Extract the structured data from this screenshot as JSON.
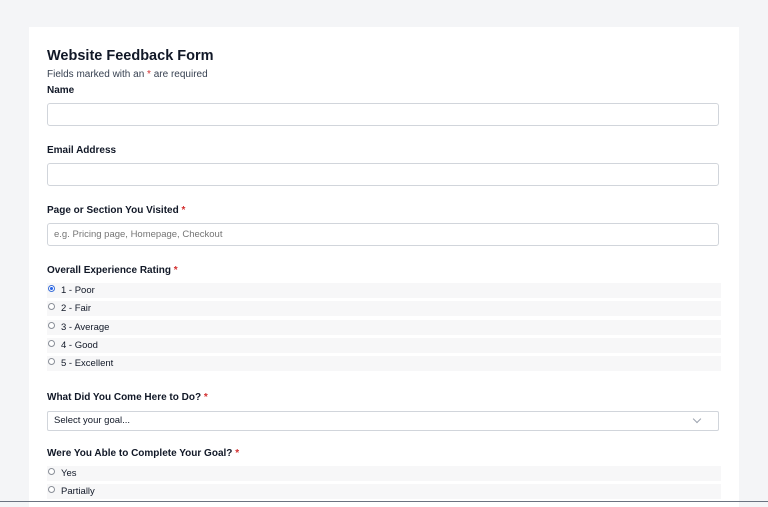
{
  "form": {
    "title": "Website Feedback Form",
    "subtitle_prefix": "Fields marked with an ",
    "required_mark": "*",
    "subtitle_suffix": " are required"
  },
  "fields": {
    "name": {
      "label": "Name",
      "value": "",
      "placeholder": ""
    },
    "email": {
      "label": "Email Address",
      "value": "",
      "placeholder": ""
    },
    "page": {
      "label": "Page or Section You Visited",
      "required": "*",
      "value": "",
      "placeholder": "e.g. Pricing page, Homepage, Checkout"
    },
    "rating": {
      "label": "Overall Experience Rating",
      "required": "*",
      "options": [
        "1 - Poor",
        "2 - Fair",
        "3 - Average",
        "4 - Good",
        "5 - Excellent"
      ],
      "selected": "1 - Poor"
    },
    "goal": {
      "label": "What Did You Come Here to Do?",
      "required": "*",
      "selected": "Select your goal..."
    },
    "completed": {
      "label": "Were You Able to Complete Your Goal?",
      "required": "*",
      "options": [
        "Yes",
        "Partially"
      ]
    }
  },
  "icons": {
    "select_arrow": "chevron-down-icon"
  },
  "colors": {
    "required": "#d32f2f",
    "radio_selected": "#2563eb"
  }
}
